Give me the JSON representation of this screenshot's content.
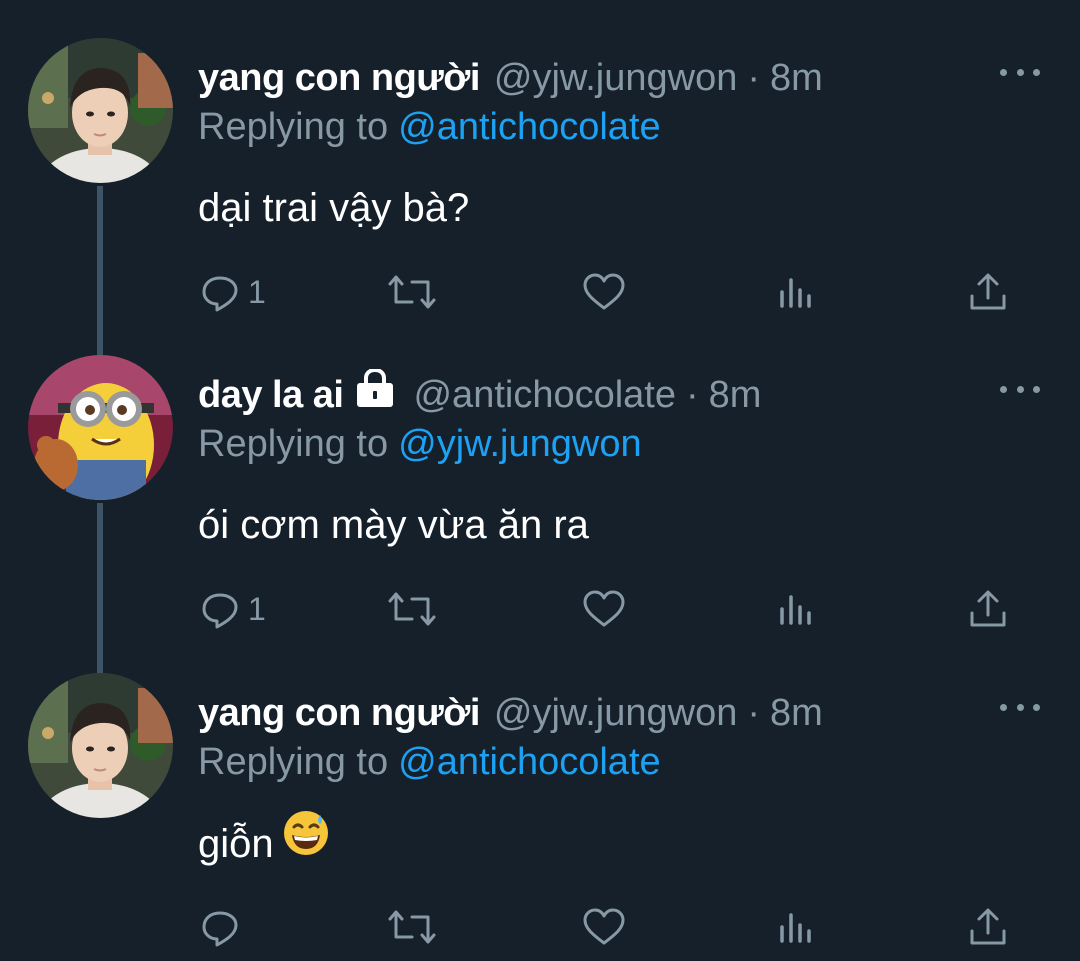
{
  "colors": {
    "background": "#15202b",
    "thread_line": "#3d5466",
    "muted": "#8899a6",
    "link": "#1da1f2",
    "text": "#ffffff"
  },
  "tweets": [
    {
      "display_name": "yang con người",
      "protected": false,
      "handle": "@yjw.jungwon",
      "separator": "·",
      "time": "8m",
      "replying_prefix": "Replying to",
      "replying_to": "@antichocolate",
      "text": "dại trai vậy bà?",
      "reply_count": "1",
      "avatar": "portrait-photo"
    },
    {
      "display_name": "day la ai",
      "protected": true,
      "handle": "@antichocolate",
      "separator": "·",
      "time": "8m",
      "replying_prefix": "Replying to",
      "replying_to": "@yjw.jungwon",
      "text": "ói cơm mày vừa ăn ra",
      "reply_count": "1",
      "avatar": "minion-photo"
    },
    {
      "display_name": "yang con người",
      "protected": false,
      "handle": "@yjw.jungwon",
      "separator": "·",
      "time": "8m",
      "replying_prefix": "Replying to",
      "replying_to": "@antichocolate",
      "text": "giỗn",
      "emoji": "grinning-face-with-sweat",
      "reply_count": "",
      "avatar": "portrait-photo"
    }
  ],
  "icons": {
    "reply": "reply-icon",
    "retweet": "retweet-icon",
    "like": "heart-icon",
    "analytics": "analytics-icon",
    "share": "share-icon",
    "more": "more-icon",
    "lock": "lock-icon"
  }
}
